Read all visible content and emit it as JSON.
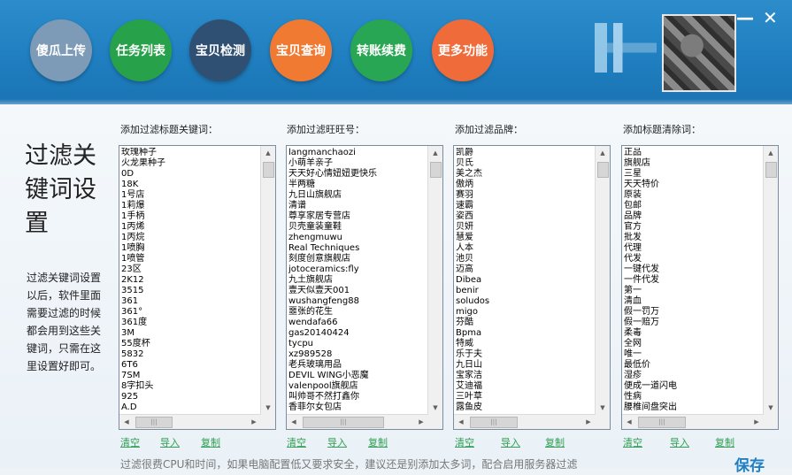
{
  "nav": {
    "buttons": [
      {
        "label": "傻瓜上传",
        "color": "#7d9ab6"
      },
      {
        "label": "任务列表",
        "color": "#27a24a"
      },
      {
        "label": "宝贝检测",
        "color": "#2f5072"
      },
      {
        "label": "宝贝查询",
        "color": "#f07a31"
      },
      {
        "label": "转账续费",
        "color": "#29a653"
      },
      {
        "label": "更多功能",
        "color": "#ef6b3a"
      }
    ],
    "minimize_glyph": "—",
    "close_glyph": "✕"
  },
  "page": {
    "title": "过滤关键词设置",
    "description": "过滤关键词设置以后，软件里面需要过滤的时候都会用到这些关键词，只需在这里设置好即可。"
  },
  "columns": [
    {
      "label": "添加过滤标题关键词：",
      "items": [
        "玫瑰种子",
        "火龙果种子",
        "0D",
        "18K",
        "1号店",
        "1莉爆",
        "1手柄",
        "1丙烯",
        "1丙烷",
        "1喷胸",
        "1喷管",
        "23区",
        "2K12",
        "3515",
        "361",
        "361°",
        "361度",
        "3M",
        "55度杯",
        "5832",
        "6T6",
        "7SM",
        "8字扣头",
        "925",
        "A.D"
      ]
    },
    {
      "label": "添加过滤旺旺号：",
      "items": [
        "langmanchaozi",
        "小萌羊亲子",
        "天天好心情妞妞更快乐",
        "半两糖",
        "九日山旗舰店",
        "清谱",
        "尊享家居专营店",
        "贝壳童装童鞋",
        "zhengmuwu",
        "Real Techniques",
        "刻度创意旗舰店",
        "jotoceramics:fly",
        "九土旗舰店",
        "壹天似壹天001",
        "wushangfeng88",
        "噩张的花生",
        "wendafa66",
        "gas20140424",
        "tycpu",
        "xz989528",
        "老兵玻璃用品",
        "DEVIL WING小恶魔",
        "valenpool旗舰店",
        "叫帅哥不然打鑫你",
        "香菲尔女包店"
      ]
    },
    {
      "label": "添加过滤品牌：",
      "items": [
        "凯爵",
        "贝氏",
        "美之杰",
        "傲炳",
        "赛羽",
        "速霸",
        "姿西",
        "贝妍",
        "慧爱",
        "人本",
        "池贝",
        "迈高",
        "Dibea",
        "benir",
        "soludos",
        "migo",
        "芬酷",
        "Bpma",
        "特威",
        "乐于夫",
        "九日山",
        "宝家洁",
        "艾迪福",
        "三叶草",
        "露鱼皮"
      ]
    },
    {
      "label": "添加标题清除词：",
      "items": [
        "正品",
        "旗舰店",
        "三星",
        "天天特价",
        "原装",
        "包邮",
        "品牌",
        "官方",
        "批发",
        "代理",
        "代发",
        "一键代发",
        "一件代发",
        "第一",
        "清血",
        "假一罚万",
        "假一赔万",
        "柔毒",
        "全网",
        "唯一",
        "最低价",
        "湿疹",
        "便成一道闪电",
        "性病",
        "腰椎间盘突出"
      ]
    }
  ],
  "actions": {
    "clear": "清空",
    "import": "导入",
    "copy": "复制"
  },
  "footer": {
    "note": "过滤很费CPU和时间，如果电脑配置低又要求安全，建议还是别添加太多词，配合启用服务器过滤",
    "save_label": "保存"
  }
}
